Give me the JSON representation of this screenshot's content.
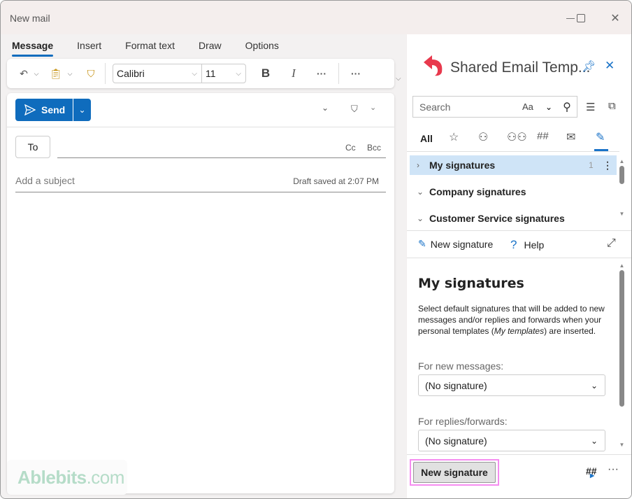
{
  "window": {
    "title": "New mail"
  },
  "tabs": [
    {
      "label": "Message"
    },
    {
      "label": "Insert"
    },
    {
      "label": "Format text"
    },
    {
      "label": "Draw"
    },
    {
      "label": "Options"
    }
  ],
  "ribbon": {
    "font": "Calibri",
    "size": "11",
    "bold": "B",
    "italic": "I",
    "more1": "···",
    "more2": "···"
  },
  "compose": {
    "send_label": "Send",
    "to_label": "To",
    "cc_label": "Cc",
    "bcc_label": "Bcc",
    "subject_placeholder": "Add a subject",
    "draft_status": "Draft saved at 2:07 PM"
  },
  "watermark": {
    "brand": "Ablebits",
    "suffix": ".com"
  },
  "pane": {
    "title": "Shared Email Temp...",
    "search_placeholder": "Search",
    "match_case": "Aa",
    "filter_all": "All",
    "hash": "##",
    "folders": [
      {
        "name": "My signatures",
        "count": "1",
        "expanded": false
      },
      {
        "name": "Company signatures",
        "count": "",
        "expanded": true
      },
      {
        "name": "Customer Service signatures",
        "count": "",
        "expanded": true
      }
    ],
    "new_signature_label": "New signature",
    "help_label": "Help",
    "detail": {
      "heading": "My signatures",
      "desc_1": "Select default signatures that will be added to new messages and/or replies and forwards when your personal templates (",
      "desc_em": "My templates",
      "desc_2": ") are inserted.",
      "new_messages_label": "For new messages:",
      "new_messages_value": "(No signature)",
      "replies_label": "For replies/forwards:",
      "replies_value": "(No signature)"
    },
    "footer_button": "New signature",
    "footer_more": "···"
  }
}
